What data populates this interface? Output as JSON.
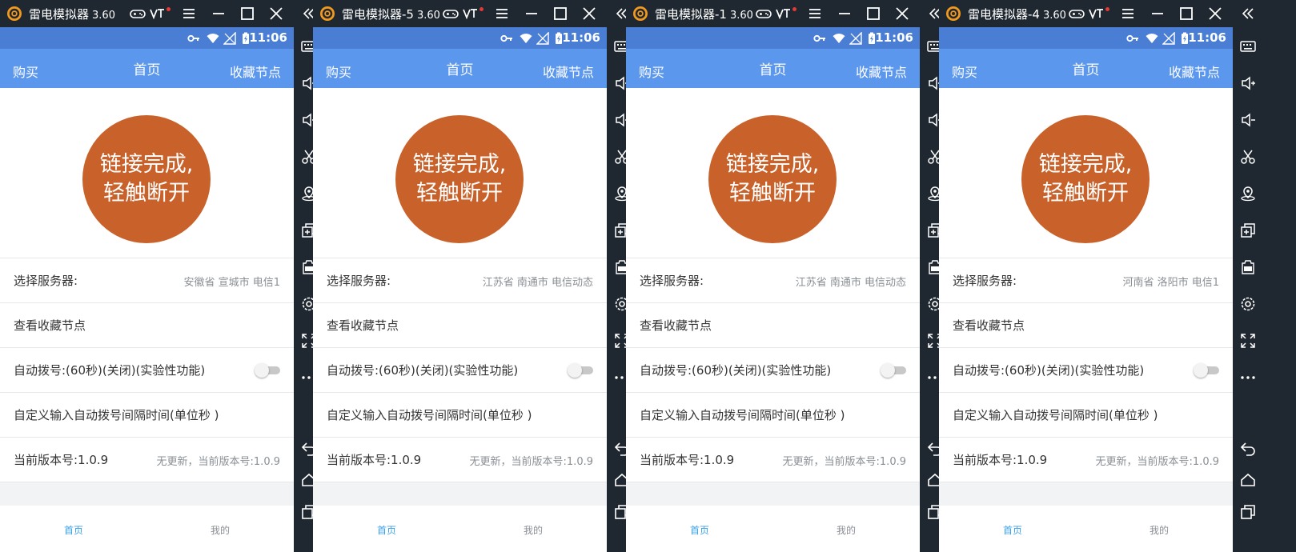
{
  "colors": {
    "frame": "#1f2730",
    "statusbar": "#4a7ed4",
    "appbar": "#5b97ec",
    "circle": "#c9622a",
    "nav_active": "#3aa0e8",
    "muted": "#8a8f94"
  },
  "windows": [
    {
      "title": "雷电模拟器",
      "version": "3.60",
      "status_time": "11:06",
      "appbar": {
        "left": "购买",
        "center": "首页",
        "right": "收藏节点"
      },
      "connect": {
        "line1": "链接完成,",
        "line2": "轻触断开"
      },
      "rows": {
        "server_label": "选择服务器:",
        "server_value": "安徽省 宣城市 电信1",
        "favorites_label": "查看收藏节点",
        "auto_dial_label": "自动拨号:(60秒)(关闭)(实验性功能)",
        "custom_interval_label": "自定义输入自动拨号间隔时间(单位秒 )",
        "version_label": "当前版本号:1.0.9",
        "version_value": "无更新，当前版本号:1.0.9"
      },
      "nav": {
        "home": "首页",
        "me": "我的"
      }
    },
    {
      "title": "雷电模拟器-5",
      "version": "3.60",
      "status_time": "11:06",
      "appbar": {
        "left": "购买",
        "center": "首页",
        "right": "收藏节点"
      },
      "connect": {
        "line1": "链接完成,",
        "line2": "轻触断开"
      },
      "rows": {
        "server_label": "选择服务器:",
        "server_value": "江苏省 南通市 电信动态",
        "favorites_label": "查看收藏节点",
        "auto_dial_label": "自动拨号:(60秒)(关闭)(实验性功能)",
        "custom_interval_label": "自定义输入自动拨号间隔时间(单位秒 )",
        "version_label": "当前版本号:1.0.9",
        "version_value": "无更新，当前版本号:1.0.9"
      },
      "nav": {
        "home": "首页",
        "me": "我的"
      }
    },
    {
      "title": "雷电模拟器-1",
      "version": "3.60",
      "status_time": "11:06",
      "appbar": {
        "left": "购买",
        "center": "首页",
        "right": "收藏节点"
      },
      "connect": {
        "line1": "链接完成,",
        "line2": "轻触断开"
      },
      "rows": {
        "server_label": "选择服务器:",
        "server_value": "江苏省 南通市 电信动态",
        "favorites_label": "查看收藏节点",
        "auto_dial_label": "自动拨号:(60秒)(关闭)(实验性功能)",
        "custom_interval_label": "自定义输入自动拨号间隔时间(单位秒 )",
        "version_label": "当前版本号:1.0.9",
        "version_value": "无更新，当前版本号:1.0.9"
      },
      "nav": {
        "home": "首页",
        "me": "我的"
      }
    },
    {
      "title": "雷电模拟器-4",
      "version": "3.60",
      "status_time": "11:06",
      "appbar": {
        "left": "购买",
        "center": "首页",
        "right": "收藏节点"
      },
      "connect": {
        "line1": "链接完成,",
        "line2": "轻触断开"
      },
      "rows": {
        "server_label": "选择服务器:",
        "server_value": "河南省 洛阳市 电信1",
        "favorites_label": "查看收藏节点",
        "auto_dial_label": "自动拨号:(60秒)(关闭)(实验性功能)",
        "custom_interval_label": "自定义输入自动拨号间隔时间(单位秒 )",
        "version_label": "当前版本号:1.0.9",
        "version_value": "无更新，当前版本号:1.0.9"
      },
      "nav": {
        "home": "首页",
        "me": "我的"
      }
    }
  ]
}
